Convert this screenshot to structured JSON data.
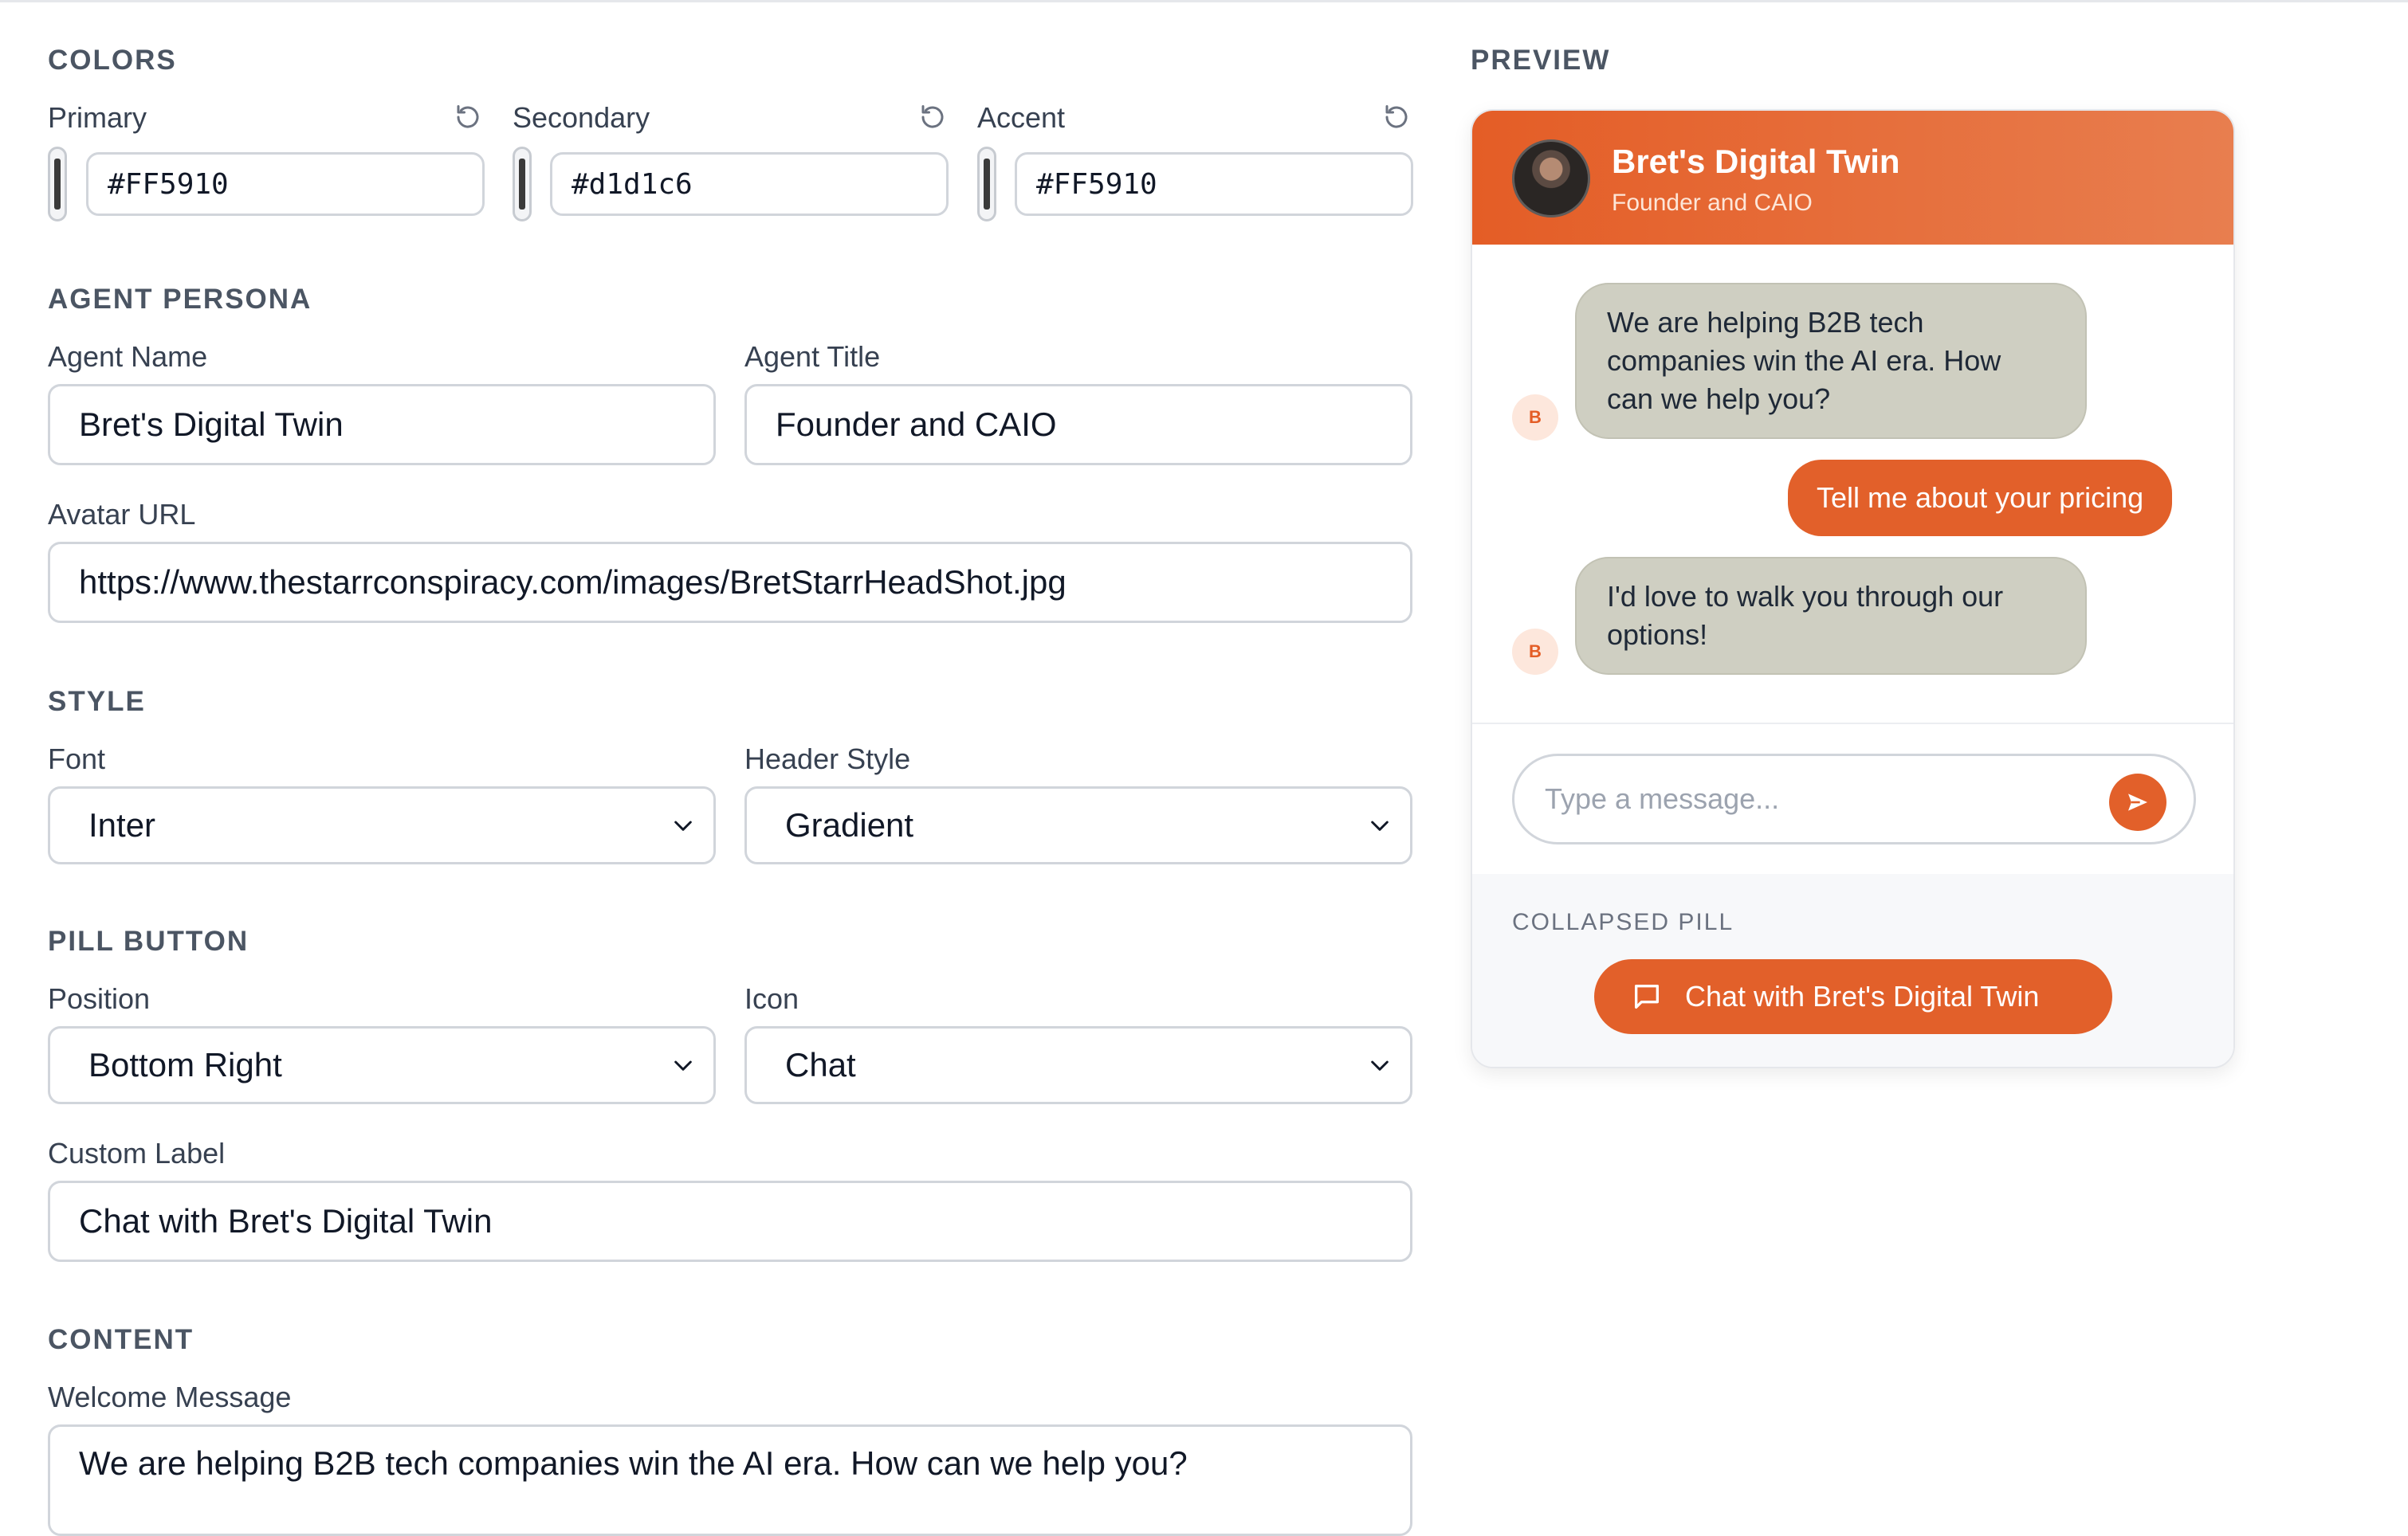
{
  "colors": {
    "section_title": "COLORS",
    "primary": {
      "label": "Primary",
      "value": "#FF5910"
    },
    "secondary": {
      "label": "Secondary",
      "value": "#d1d1c6"
    },
    "accent": {
      "label": "Accent",
      "value": "#FF5910"
    }
  },
  "persona": {
    "section_title": "AGENT PERSONA",
    "agent_name_label": "Agent Name",
    "agent_name": "Bret's Digital Twin",
    "agent_title_label": "Agent Title",
    "agent_title": "Founder and CAIO",
    "avatar_url_label": "Avatar URL",
    "avatar_url": "https://www.thestarrconspiracy.com/images/BretStarrHeadShot.jpg"
  },
  "style": {
    "section_title": "STYLE",
    "font_label": "Font",
    "font": "Inter",
    "header_style_label": "Header Style",
    "header_style": "Gradient"
  },
  "pill_button": {
    "section_title": "PILL BUTTON",
    "position_label": "Position",
    "position": "Bottom Right",
    "icon_label": "Icon",
    "icon": "Chat",
    "custom_label_label": "Custom Label",
    "custom_label": "Chat with Bret's Digital Twin"
  },
  "content": {
    "section_title": "CONTENT",
    "welcome_label": "Welcome Message",
    "welcome_message": "We are helping B2B tech companies win the AI era. How can we help you?"
  },
  "preview": {
    "section_title": "PREVIEW",
    "header_name": "Bret's Digital Twin",
    "header_title": "Founder and CAIO",
    "bot_initial": "B",
    "messages": [
      {
        "role": "bot",
        "text": "We are helping B2B tech companies win the AI era. How can we help you?"
      },
      {
        "role": "user",
        "text": "Tell me about your pricing"
      },
      {
        "role": "bot",
        "text": "I'd love to walk you through our options!"
      }
    ],
    "input_placeholder": "Type a message...",
    "collapsed_label": "COLLAPSED PILL",
    "pill_text": "Chat with Bret's Digital Twin"
  },
  "theme": {
    "accent_color": "#e2602a",
    "bubble_color": "#cfcfc2"
  },
  "icons": [
    "reset-icon",
    "chevron-down-icon",
    "send-icon",
    "chat-icon"
  ]
}
